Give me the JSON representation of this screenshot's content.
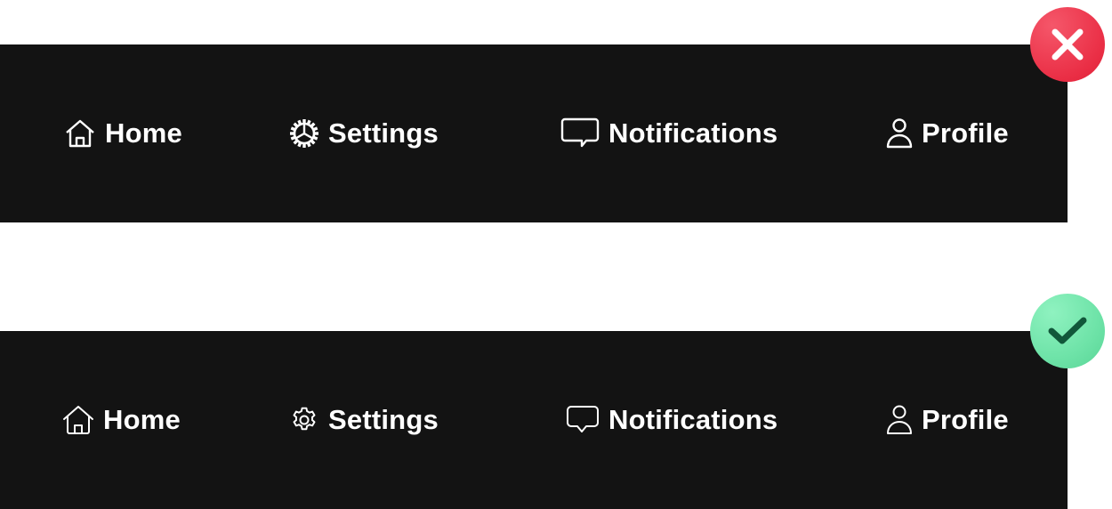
{
  "examples": [
    {
      "verdict": "incorrect",
      "verdict_icon": "x-icon",
      "verdict_color": "#ea2e45",
      "nav_items": [
        {
          "label": "Home",
          "icon": "home-icon"
        },
        {
          "label": "Settings",
          "icon": "gear-icon"
        },
        {
          "label": "Notifications",
          "icon": "speech-bubble-icon"
        },
        {
          "label": "Profile",
          "icon": "user-icon"
        }
      ]
    },
    {
      "verdict": "correct",
      "verdict_icon": "checkmark-icon",
      "verdict_color": "#6ee3a8",
      "nav_items": [
        {
          "label": "Home",
          "icon": "home-icon"
        },
        {
          "label": "Settings",
          "icon": "gear-icon"
        },
        {
          "label": "Notifications",
          "icon": "speech-bubble-icon"
        },
        {
          "label": "Profile",
          "icon": "user-icon"
        }
      ]
    }
  ],
  "colors": {
    "navbar_background": "#131313",
    "nav_text": "#ffffff"
  }
}
